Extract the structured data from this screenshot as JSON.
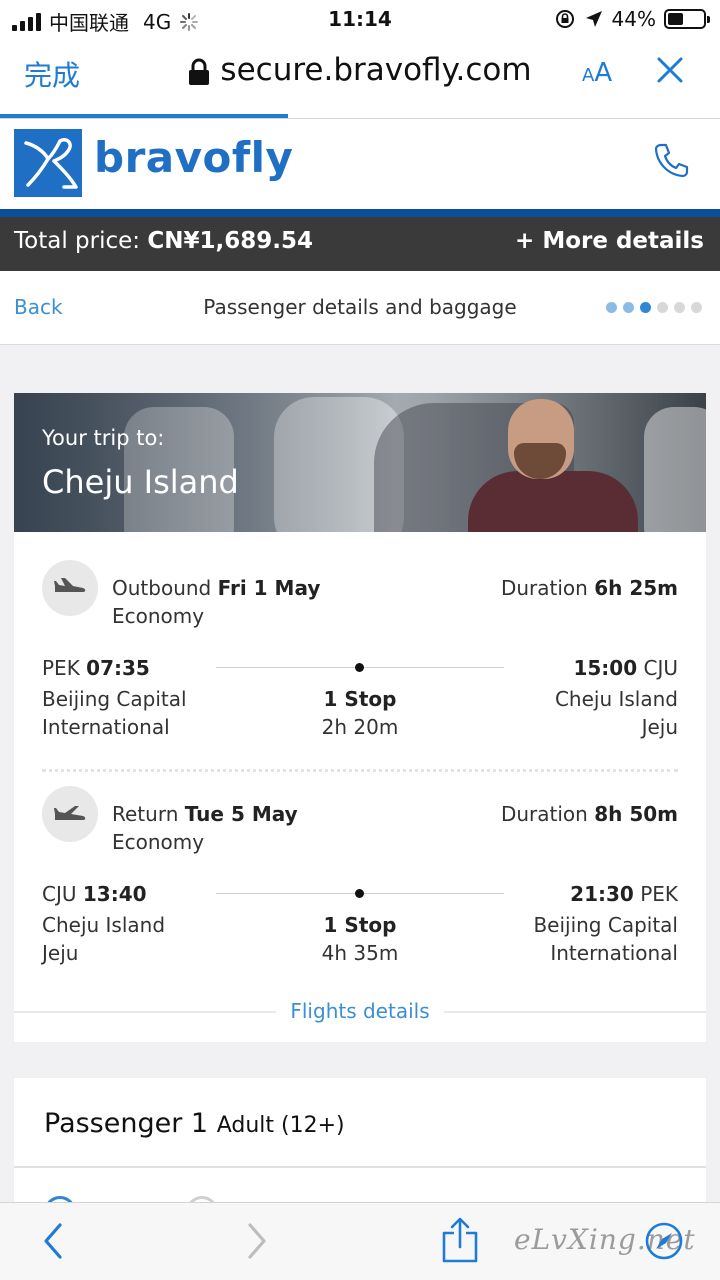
{
  "status_bar": {
    "carrier": "中国联通",
    "network": "4G",
    "time": "11:14",
    "battery": "44%",
    "battery_level": 0.44
  },
  "browser": {
    "done_label": "完成",
    "url": "secure.bravofly.com",
    "text_size_label_small": "A",
    "text_size_label_large": "A",
    "load_progress": 0.4
  },
  "site": {
    "brand": "bravofly",
    "brand_color": "#1f6fc5"
  },
  "price_bar": {
    "label": "Total price: ",
    "amount": "CN¥1,689.54",
    "more_details": "+ More details"
  },
  "step_nav": {
    "back": "Back",
    "title": "Passenger details and baggage",
    "current_step": 3,
    "total_steps": 6
  },
  "hero": {
    "subtitle": "Your trip to:",
    "destination": "Cheju Island"
  },
  "legs": [
    {
      "direction": "Outbound",
      "date": "Fri 1 May",
      "cabin": "Economy",
      "duration_label": "Duration",
      "duration": "6h 25m",
      "dep_code": "PEK",
      "dep_time": "07:35",
      "dep_city_line1": "Beijing Capital",
      "dep_city_line2": "International",
      "arr_time": "15:00",
      "arr_code": "CJU",
      "arr_city_line1": "Cheju Island",
      "arr_city_line2": "Jeju",
      "stops": "1 Stop",
      "stop_duration": "2h 20m"
    },
    {
      "direction": "Return",
      "date": "Tue 5 May",
      "cabin": "Economy",
      "duration_label": "Duration",
      "duration": "8h 50m",
      "dep_code": "CJU",
      "dep_time": "13:40",
      "dep_city_line1": "Cheju Island",
      "dep_city_line2": "Jeju",
      "arr_time": "21:30",
      "arr_code": "PEK",
      "arr_city_line1": "Beijing Capital",
      "arr_city_line2": "International",
      "stops": "1 Stop",
      "stop_duration": "4h 35m"
    }
  ],
  "flights_details": "Flights details",
  "passenger": {
    "title": "Passenger 1",
    "type": "Adult (12+)"
  },
  "watermark": "eLvXing.net",
  "colors": {
    "link_blue": "#3a8fd6",
    "ios_blue": "#1e7bd6",
    "price_bar_bg": "#3a3a3a",
    "header_stripe": "#0b4f9b"
  }
}
